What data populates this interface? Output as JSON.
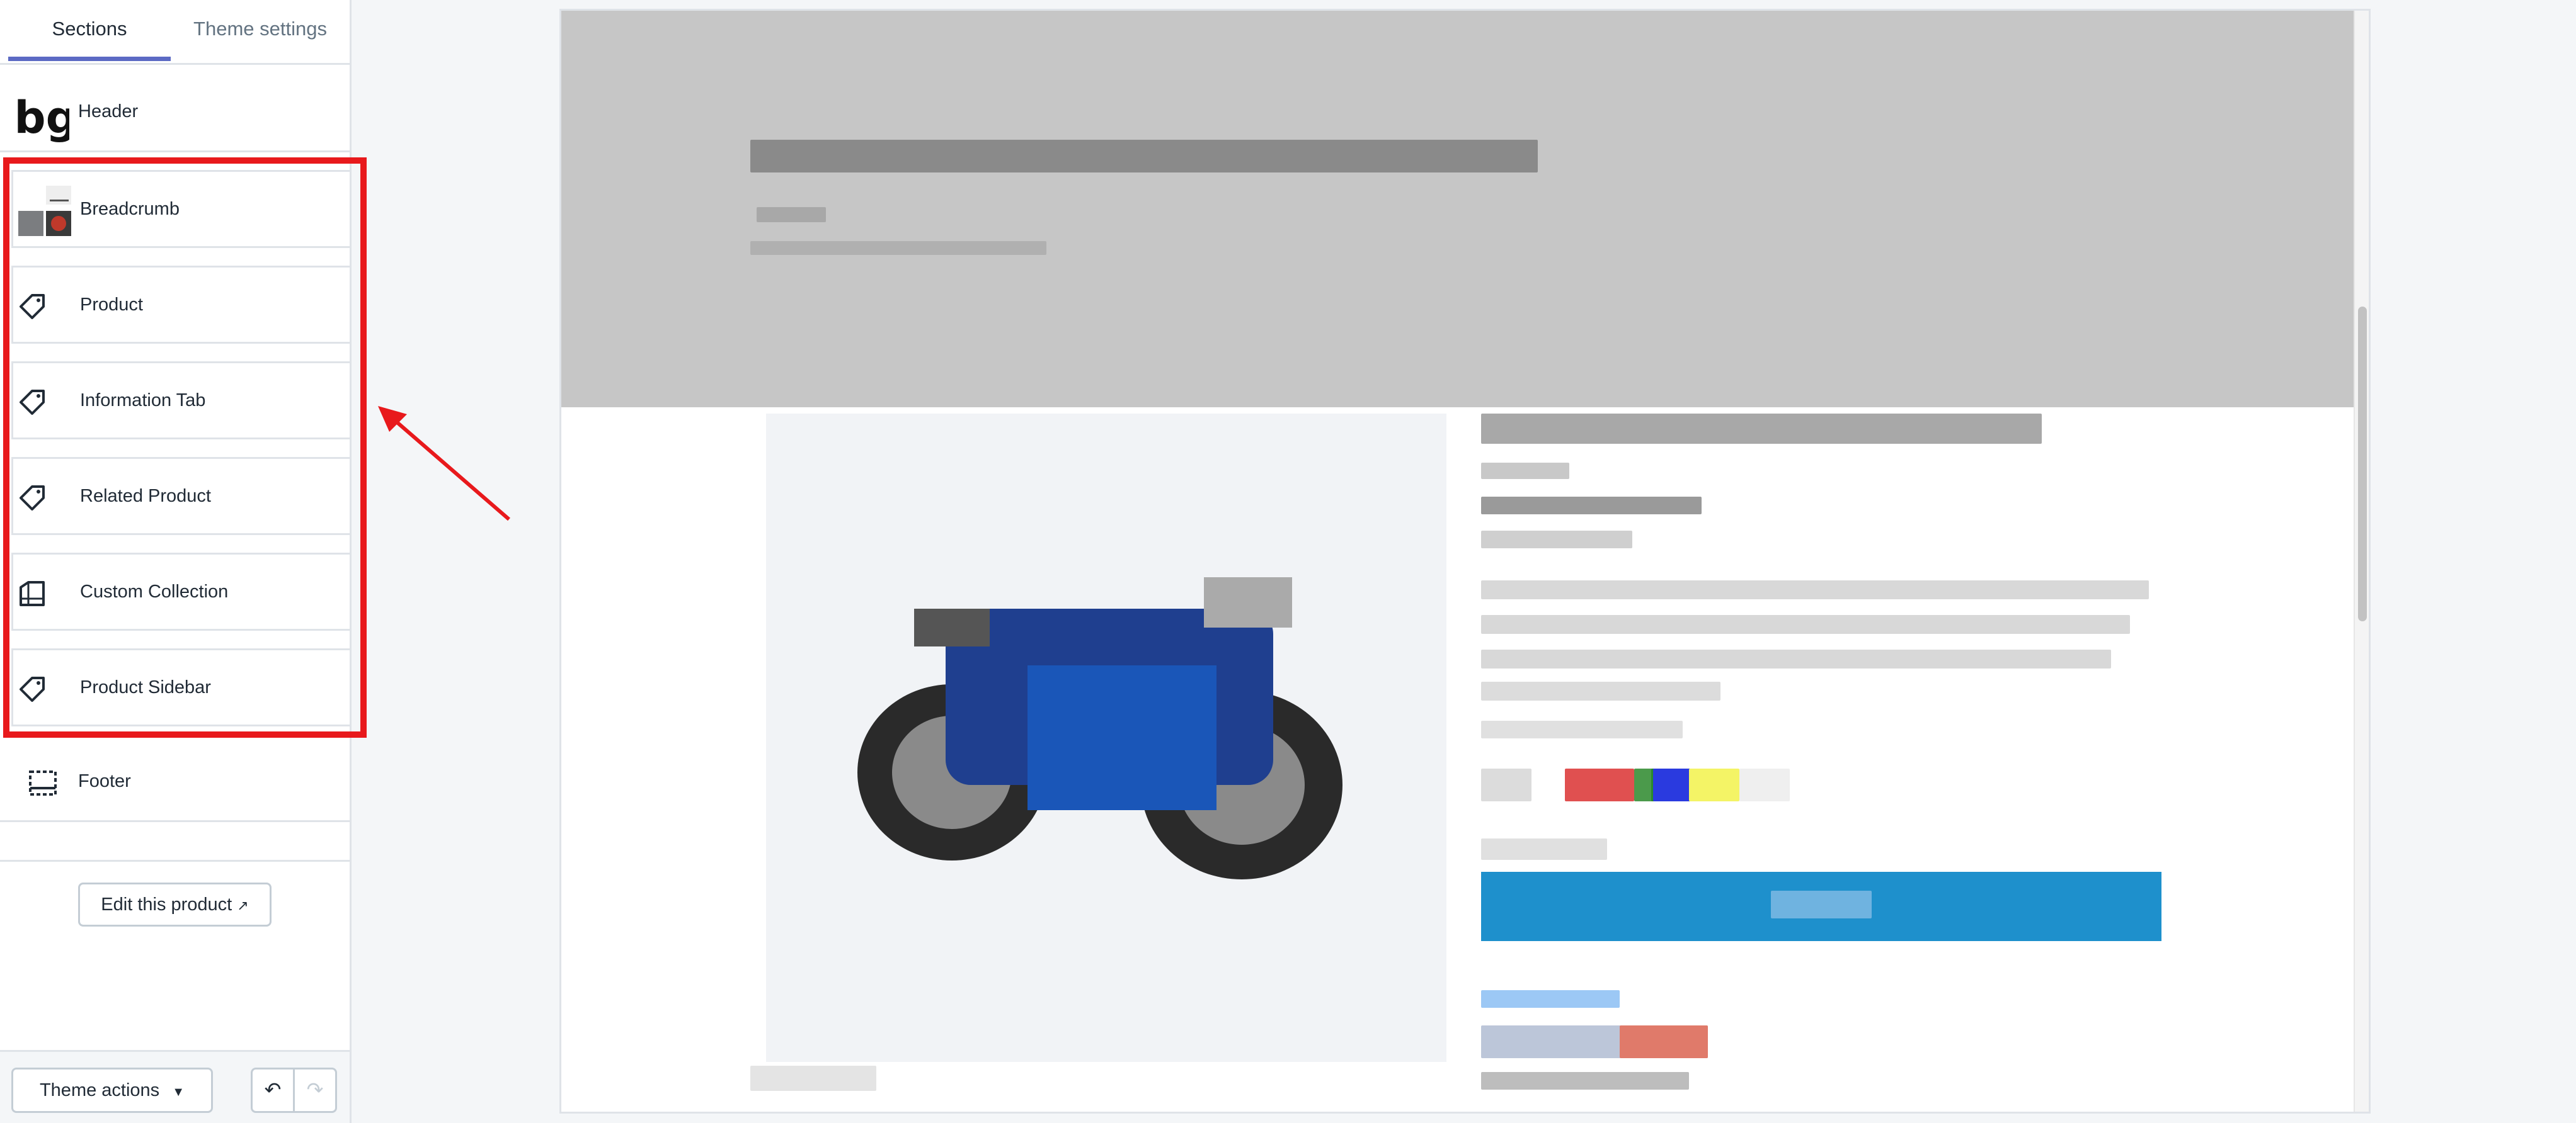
{
  "sidebar": {
    "tabs": [
      {
        "label": "Sections",
        "active": true
      },
      {
        "label": "Theme settings",
        "active": false
      }
    ],
    "sections": [
      {
        "label": "Header",
        "icon": "header-logo-thumbnail"
      },
      {
        "label": "Breadcrumb",
        "icon": "breadcrumb-image-thumbnail"
      },
      {
        "label": "Product",
        "icon": "tag-icon"
      },
      {
        "label": "Information Tab",
        "icon": "tag-icon"
      },
      {
        "label": "Related Product",
        "icon": "tag-icon"
      },
      {
        "label": "Custom Collection",
        "icon": "collection-icon"
      },
      {
        "label": "Product Sidebar",
        "icon": "tag-icon"
      },
      {
        "label": "Footer",
        "icon": "footer-layout-icon"
      }
    ],
    "edit_button": "Edit this product",
    "theme_actions": "Theme actions"
  },
  "colors": {
    "accent": "#5c6ac4",
    "highlight": "#e8191c",
    "buy_button": "#1e90cc"
  }
}
